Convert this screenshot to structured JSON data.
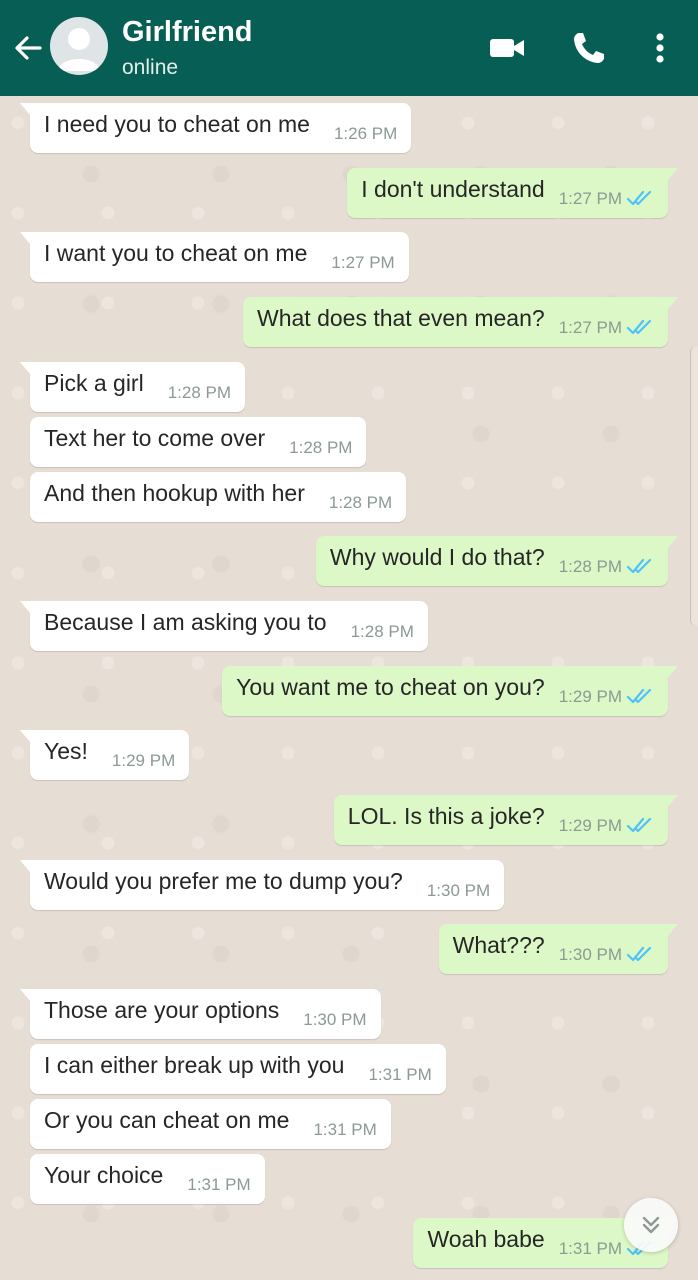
{
  "header": {
    "contact_name": "Girlfriend",
    "status": "online",
    "bg_color": "#075e54"
  },
  "icons": {
    "back": "arrow-left-icon",
    "avatar": "default-avatar-icon",
    "video": "video-call-icon",
    "call": "phone-icon",
    "menu": "more-vertical-icon",
    "scroll": "double-chevron-down-icon"
  },
  "colors": {
    "incoming_bubble": "#ffffff",
    "outgoing_bubble": "#dcf8c6",
    "read_ticks": "#4fc3f7"
  },
  "messages": [
    {
      "dir": "in",
      "text": "I need you to cheat on me",
      "time": "1:26 PM"
    },
    {
      "dir": "out",
      "text": "I don't understand",
      "time": "1:27 PM"
    },
    {
      "dir": "in",
      "text": "I want you to cheat on me",
      "time": "1:27 PM"
    },
    {
      "dir": "out",
      "text": "What does that even mean?",
      "time": "1:27 PM"
    },
    {
      "dir": "in",
      "text": "Pick a girl",
      "time": "1:28 PM"
    },
    {
      "dir": "in",
      "text": "Text her to come over",
      "time": "1:28 PM"
    },
    {
      "dir": "in",
      "text": "And then hookup with her",
      "time": "1:28 PM"
    },
    {
      "dir": "out",
      "text": "Why would I do that?",
      "time": "1:28 PM"
    },
    {
      "dir": "in",
      "text": "Because I am asking you to",
      "time": "1:28 PM"
    },
    {
      "dir": "out",
      "text": "You want me to cheat on you?",
      "time": "1:29 PM"
    },
    {
      "dir": "in",
      "text": "Yes!",
      "time": "1:29 PM"
    },
    {
      "dir": "out",
      "text": "LOL. Is this a joke?",
      "time": "1:29 PM"
    },
    {
      "dir": "in",
      "text": "Would you prefer me to dump you?",
      "time": "1:30 PM"
    },
    {
      "dir": "out",
      "text": "What???",
      "time": "1:30 PM"
    },
    {
      "dir": "in",
      "text": "Those are your options",
      "time": "1:30 PM"
    },
    {
      "dir": "in",
      "text": "I can either break up with you",
      "time": "1:31 PM"
    },
    {
      "dir": "in",
      "text": "Or you can cheat on me",
      "time": "1:31 PM"
    },
    {
      "dir": "in",
      "text": "Your choice",
      "time": "1:31 PM"
    },
    {
      "dir": "out",
      "text": "Woah babe",
      "time": "1:31 PM"
    }
  ]
}
